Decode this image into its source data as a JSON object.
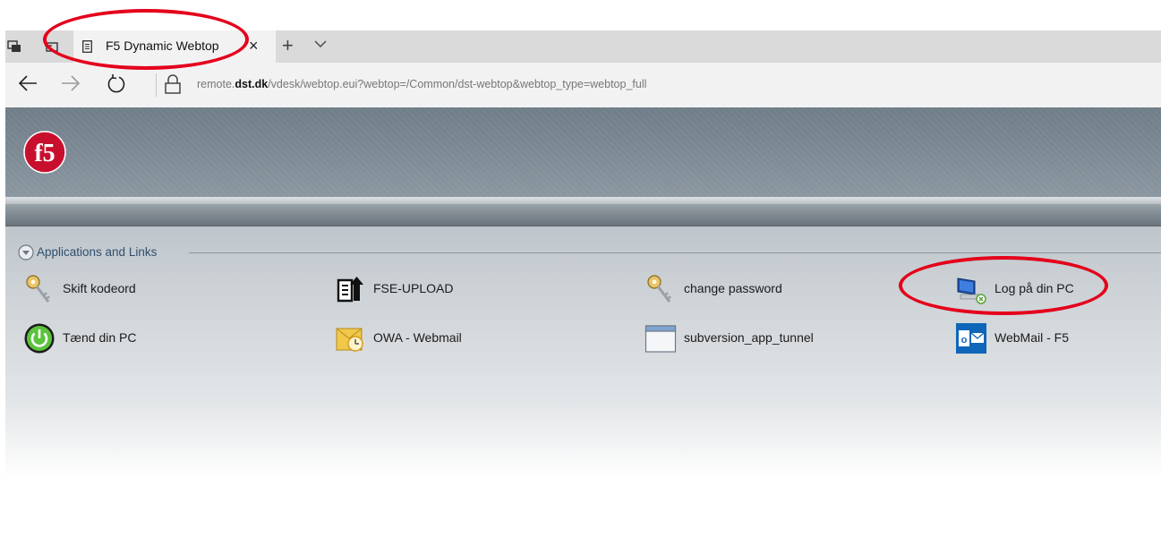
{
  "browser": {
    "tab": {
      "title": "F5 Dynamic Webtop",
      "close": "×"
    },
    "new_tab": "+",
    "url": {
      "prefix": "remote.",
      "domain": "dst.dk",
      "path": "/vdesk/webtop.eui?webtop=/Common/dst-webtop&webtop_type=webtop_full"
    }
  },
  "webtop": {
    "logo": "f5",
    "section_title": "Applications and Links",
    "apps": [
      {
        "label": "Skift kodeord",
        "icon": "key-icon"
      },
      {
        "label": "FSE-UPLOAD",
        "icon": "upload-icon"
      },
      {
        "label": "change password",
        "icon": "key-icon"
      },
      {
        "label": "Log på din PC",
        "icon": "remote-desktop-icon"
      },
      {
        "label": "Tænd din PC",
        "icon": "power-icon"
      },
      {
        "label": "OWA - Webmail",
        "icon": "mail-clock-icon"
      },
      {
        "label": "subversion_app_tunnel",
        "icon": "window-icon"
      },
      {
        "label": "WebMail - F5",
        "icon": "outlook-icon"
      }
    ]
  },
  "colors": {
    "annotation": "#e4001b",
    "logo_red": "#c8102e",
    "banner": "#7a8792"
  }
}
